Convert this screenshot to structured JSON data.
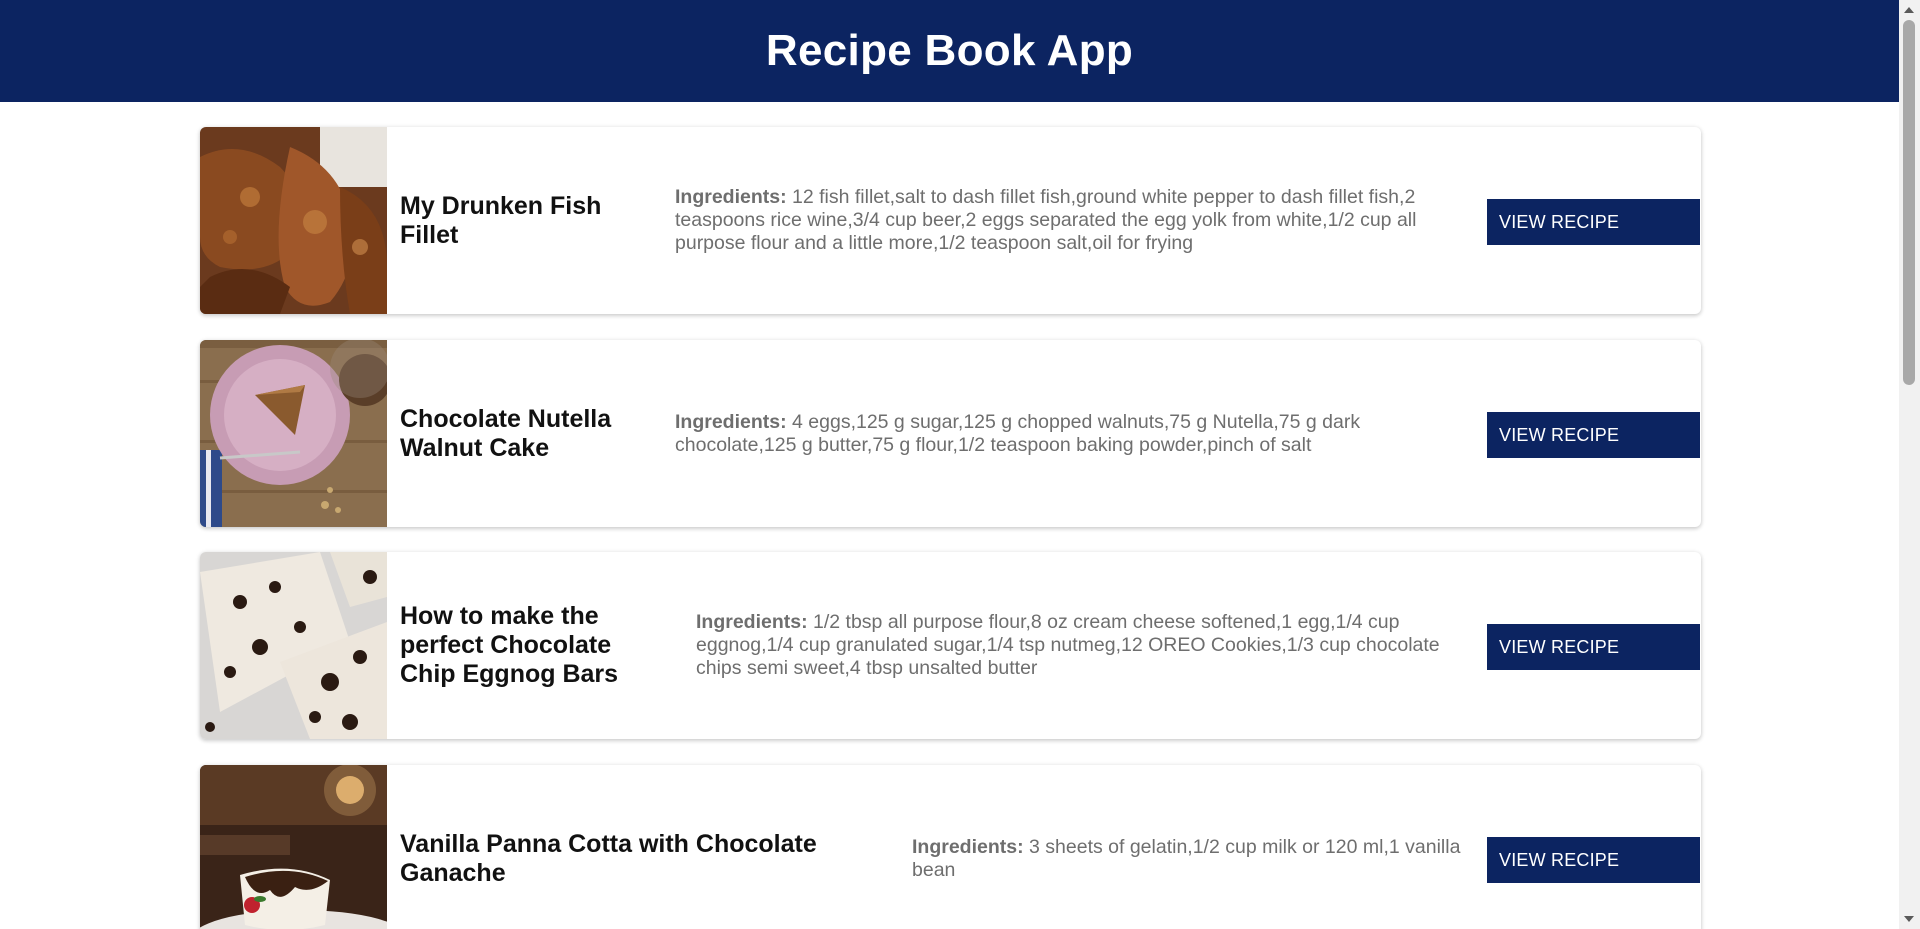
{
  "app": {
    "title": "Recipe Book App"
  },
  "colors": {
    "header_bg": "#0c2461",
    "button_bg": "#0c2461",
    "ingredients_text": "#6e6e6e"
  },
  "ingredients_label": "Ingredients:",
  "recipes": [
    {
      "title": "My Drunken Fish Fillet",
      "ingredients": "12 fish fillet,salt to dash fillet fish,ground white pepper to dash fillet fish,2 teaspoons rice wine,3/4 cup beer,2 eggs separated the egg yolk from white,1/2 cup all purpose flour and a little more,1/2 teaspoon salt,oil for frying",
      "button_label": "VIEW RECIPE",
      "image_icon": "fried-fish-photo"
    },
    {
      "title": "Chocolate Nutella Walnut Cake",
      "ingredients": "4 eggs,125 g sugar,125 g chopped walnuts,75 g Nutella,75 g dark chocolate,125 g butter,75 g flour,1/2 teaspoon baking powder,pinch of salt",
      "button_label": "VIEW RECIPE",
      "image_icon": "cake-slice-photo"
    },
    {
      "title": "How to make the perfect Chocolate Chip Eggnog Bars",
      "ingredients": "1/2 tbsp all purpose flour,8 oz cream cheese softened,1 egg,1/4 cup eggnog,1/4 cup granulated sugar,1/4 tsp nutmeg,12 OREO Cookies,1/3 cup chocolate chips semi sweet,4 tbsp unsalted butter",
      "button_label": "VIEW RECIPE",
      "image_icon": "eggnog-bars-photo"
    },
    {
      "title": "Vanilla Panna Cotta with Chocolate Ganache",
      "ingredients": "3 sheets of gelatin,1/2 cup milk or 120 ml,1 vanilla bean",
      "button_label": "VIEW RECIPE",
      "image_icon": "panna-cotta-photo"
    }
  ]
}
